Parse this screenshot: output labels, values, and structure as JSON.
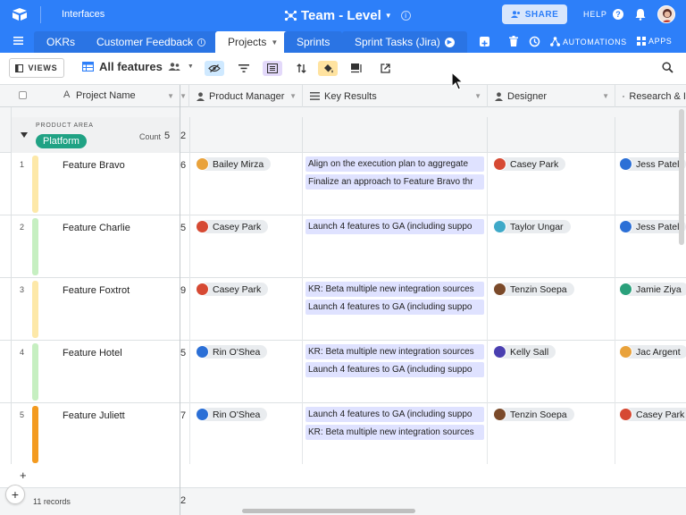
{
  "app": {
    "section_label": "Interfaces",
    "base_title": "Team - Level",
    "share_label": "SHARE",
    "help_label": "HELP",
    "help_icon": "?"
  },
  "tabs": [
    {
      "label": "OKRs",
      "active": false
    },
    {
      "label": "Customer Feedback",
      "active": false
    },
    {
      "label": "Projects",
      "active": true
    },
    {
      "label": "Sprints",
      "active": false
    },
    {
      "label": "Sprint Tasks (Jira)",
      "active": false
    }
  ],
  "tabbar": {
    "automations_label": "AUTOMATIONS",
    "apps_label": "APPS"
  },
  "toolbar": {
    "views_label": "VIEWS",
    "view_name": "All features"
  },
  "columns": [
    {
      "label": "Project Name",
      "icon": "text-field-icon"
    },
    {
      "label": "Product Manager",
      "icon": "person-field-icon"
    },
    {
      "label": "Key Results",
      "icon": "link-field-icon"
    },
    {
      "label": "Designer",
      "icon": "person-field-icon"
    },
    {
      "label": "Research & I",
      "icon": "people-field-icon"
    }
  ],
  "group": {
    "field_label": "PRODUCT AREA",
    "value": "Platform",
    "count_label": "Count",
    "count": "5",
    "partial_value": "2"
  },
  "rows": [
    {
      "num": "1",
      "name": "Feature Bravo",
      "partial": "6",
      "pm": "Bailey Mirza",
      "key_results": [
        "Align on the execution plan to aggregate",
        "Finalize an approach to Feature Bravo thr"
      ],
      "designer": "Casey Park",
      "research": "Jess Patel"
    },
    {
      "num": "2",
      "name": "Feature Charlie",
      "partial": "5",
      "pm": "Casey Park",
      "key_results": [
        "Launch 4 features to GA (including suppo"
      ],
      "designer": "Taylor Ungar",
      "research": "Jess Patel"
    },
    {
      "num": "3",
      "name": "Feature Foxtrot",
      "partial": "9",
      "pm": "Casey Park",
      "key_results": [
        "KR: Beta multiple new integration sources",
        "Launch 4 features to GA (including suppo"
      ],
      "designer": "Tenzin Soepa",
      "research": "Jamie Ziya"
    },
    {
      "num": "4",
      "name": "Feature Hotel",
      "partial": "5",
      "pm": "Rin O'Shea",
      "key_results": [
        "KR: Beta multiple new integration sources",
        "Launch 4 features to GA (including suppo"
      ],
      "designer": "Kelly Sall",
      "research": "Jac Argent"
    },
    {
      "num": "5",
      "name": "Feature Juliett",
      "partial": "7",
      "pm": "Rin O'Shea",
      "key_results": [
        "Launch 4 features to GA (including suppo",
        "KR: Beta multiple new integration sources"
      ],
      "designer": "Tenzin Soepa",
      "research": "Casey Park"
    }
  ],
  "footer": {
    "add_label": "+",
    "records": "11 records",
    "partial_value": "2"
  },
  "colors": {
    "brand": "#2d7ff9",
    "group_pill": "#20a284",
    "key_result_pill": "#dfe2ff",
    "row_colors": [
      "#fde8a8",
      "#c6efc1",
      "#fde8a8",
      "#c6efc1",
      "#f39a1f"
    ]
  }
}
